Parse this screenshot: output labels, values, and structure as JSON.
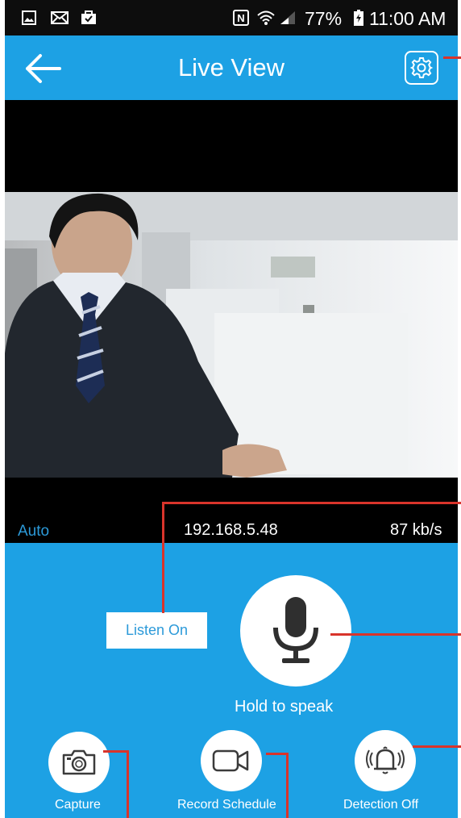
{
  "status_bar": {
    "battery": "77%",
    "time": "11:00 AM",
    "icons": [
      "image-icon",
      "mail-icon",
      "briefcase-icon",
      "nfc-icon",
      "wifi-icon",
      "signal-icon",
      "battery-icon"
    ]
  },
  "app_bar": {
    "title": "Live View",
    "back_icon": "arrow-left-icon",
    "settings_icon": "gear-icon"
  },
  "video": {
    "mode": "Auto",
    "ip": "192.168.5.48",
    "bitrate": "87 kb/s"
  },
  "controls": {
    "listen_label": "Listen On",
    "mic_icon": "microphone-icon",
    "speak_label": "Hold to speak",
    "buttons": [
      {
        "label": "Capture",
        "icon": "camera-icon"
      },
      {
        "label": "Record Schedule",
        "icon": "video-camera-icon"
      },
      {
        "label": "Detection Off",
        "icon": "bell-icon"
      }
    ]
  },
  "colors": {
    "accent": "#1da1e4",
    "status_bar": "#0d0d0d",
    "callout": "#d9342b",
    "label_blue": "#2c9ad9"
  }
}
